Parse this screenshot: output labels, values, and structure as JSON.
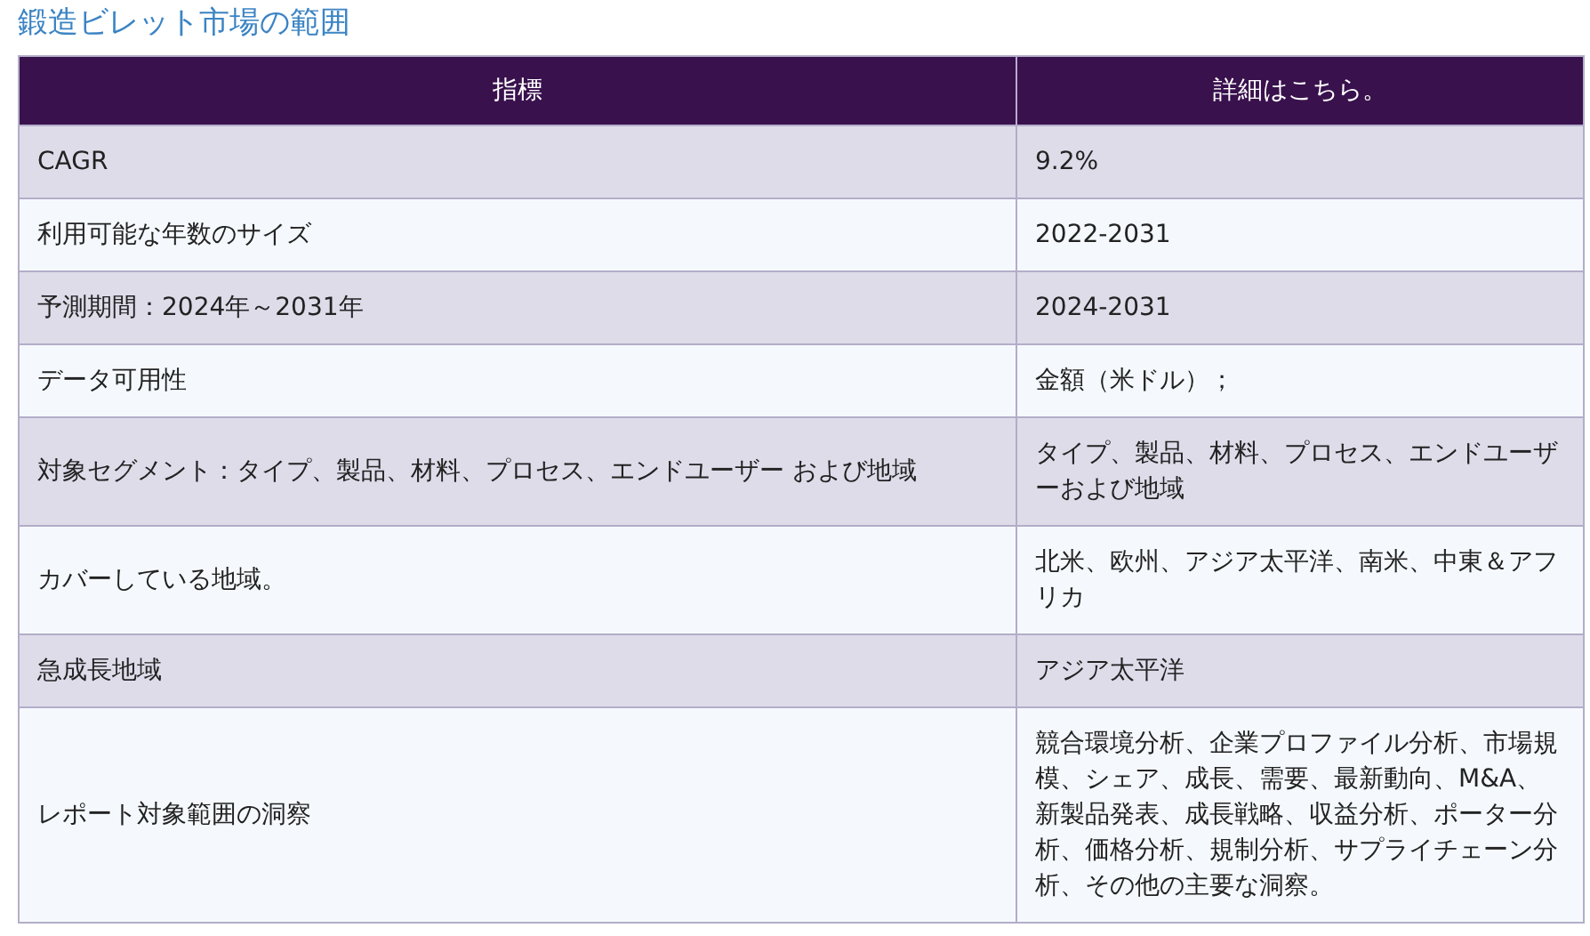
{
  "title": "鍛造ビレット市場の範囲",
  "table": {
    "columns": [
      "指標",
      "詳細はこちら。"
    ],
    "rows": [
      [
        "CAGR",
        "9.2%"
      ],
      [
        "利用可能な年数のサイズ",
        "2022-2031"
      ],
      [
        "予測期間：2024年～2031年",
        "2024-2031"
      ],
      [
        "データ可用性",
        "金額（米ドル）；"
      ],
      [
        "対象セグメント：タイプ、製品、材料、プロセス、エンドユーザー および地域",
        "タイプ、製品、材料、プロセス、エンドユーザーおよび地域"
      ],
      [
        "カバーしている地域。",
        "北米、欧州、アジア太平洋、南米、中東＆アフリカ"
      ],
      [
        "急成長地域",
        "アジア太平洋"
      ],
      [
        "レポート対象範囲の洞察",
        "競合環境分析、企業プロファイル分析、市場規模、シェア、成長、需要、最新動向、M&A、新製品発表、成長戦略、収益分析、ポーター分析、価格分析、規制分析、サプライチェーン分析、その他の主要な洞察。"
      ]
    ]
  }
}
